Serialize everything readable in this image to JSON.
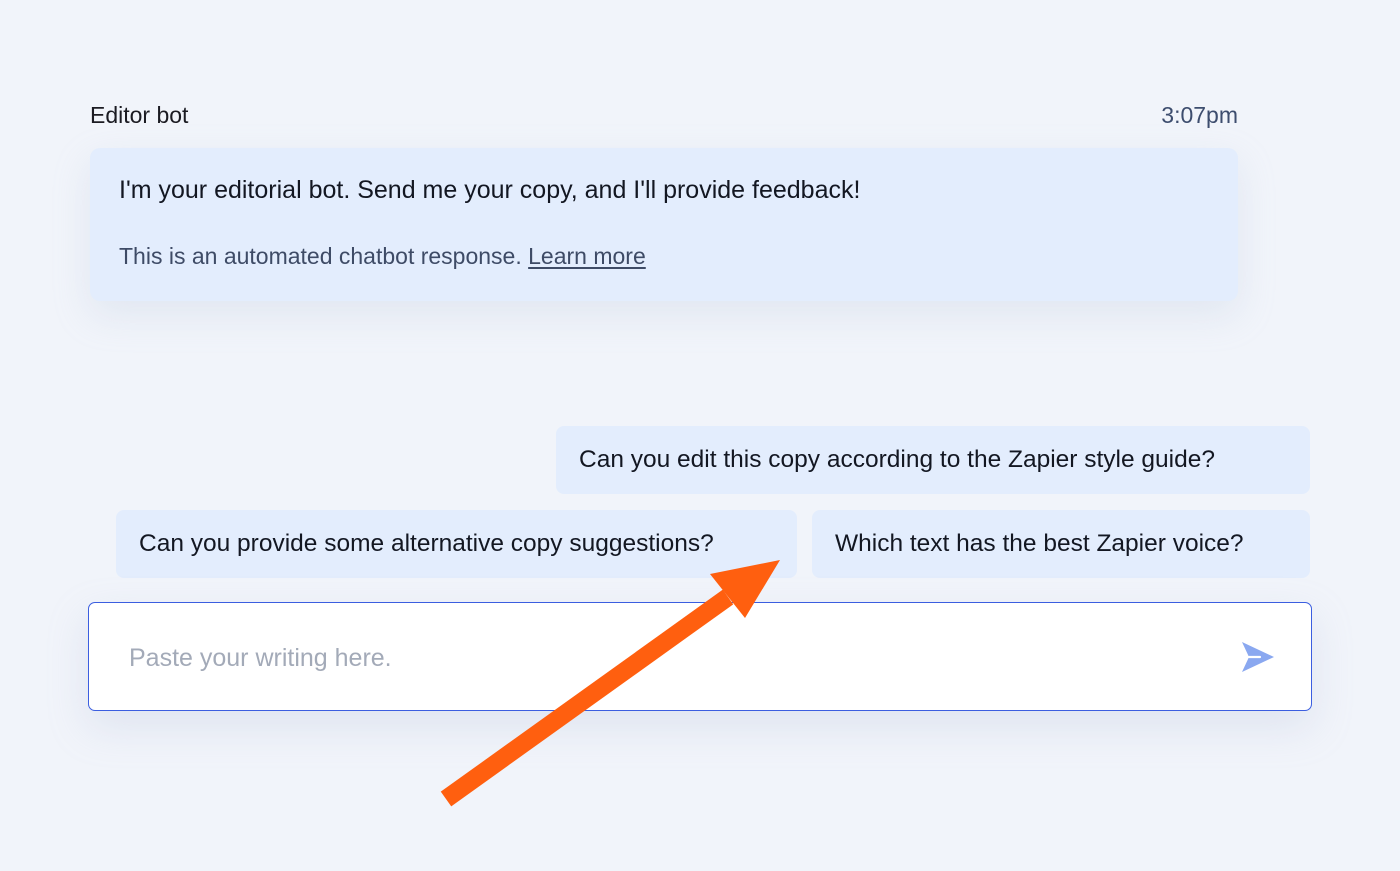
{
  "chat": {
    "bot_name": "Editor bot",
    "timestamp": "3:07pm",
    "bot_message": "I'm your editorial bot. Send me your copy, and I'll provide feedback!",
    "bot_note": "This is an automated chatbot response.",
    "learn_more": "Learn more"
  },
  "suggestions": [
    "Can you edit this copy according to the Zapier style guide?",
    "Can you provide some alternative copy suggestions?",
    "Which text has the best Zapier voice?"
  ],
  "composer": {
    "placeholder": "Paste your writing here.",
    "value": ""
  },
  "icons": {
    "send": "send-icon",
    "annotation": "arrow-annotation-icon"
  },
  "colors": {
    "page_background": "#f1f4fa",
    "bubble_background": "#e3edfd",
    "input_border": "#3b5ee0",
    "send_icon": "#8aa8f0",
    "annotation_arrow": "#ff5f0f"
  }
}
